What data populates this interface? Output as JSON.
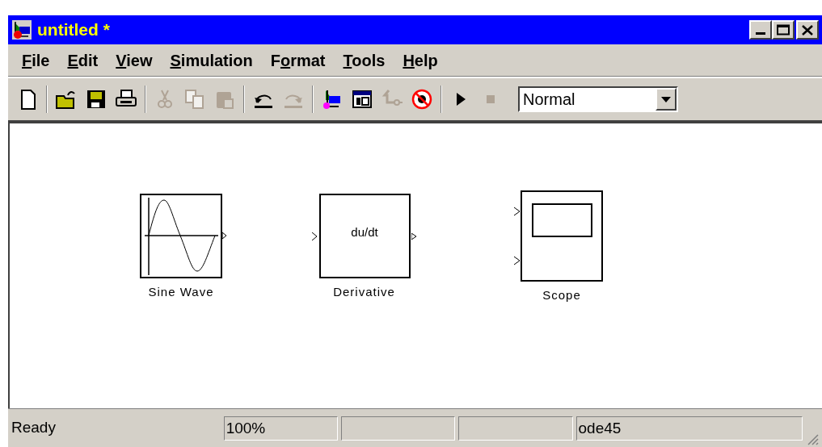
{
  "window": {
    "title": "untitled *"
  },
  "menu": [
    {
      "key": "F",
      "after": "ile"
    },
    {
      "key": "E",
      "after": "dit"
    },
    {
      "key": "V",
      "after": "iew"
    },
    {
      "key": "S",
      "after": "imulation"
    },
    {
      "before": "F",
      "key": "o",
      "after": "rmat"
    },
    {
      "key": "T",
      "after": "ools"
    },
    {
      "key": "H",
      "after": "elp"
    }
  ],
  "toolbar": [
    {
      "kind": "new",
      "disabled": false
    },
    {
      "kind": "separator"
    },
    {
      "kind": "open",
      "disabled": false
    },
    {
      "kind": "save",
      "disabled": false
    },
    {
      "kind": "print",
      "disabled": false
    },
    {
      "kind": "separator"
    },
    {
      "kind": "cut",
      "disabled": true
    },
    {
      "kind": "copy",
      "disabled": true
    },
    {
      "kind": "paste",
      "disabled": true
    },
    {
      "kind": "separator"
    },
    {
      "kind": "undo",
      "disabled": false
    },
    {
      "kind": "redo",
      "disabled": true
    },
    {
      "kind": "separator"
    },
    {
      "kind": "library",
      "disabled": false
    },
    {
      "kind": "explorer",
      "disabled": false
    },
    {
      "kind": "parent",
      "disabled": true
    },
    {
      "kind": "debug",
      "disabled": false
    },
    {
      "kind": "separator"
    },
    {
      "kind": "start",
      "disabled": false
    },
    {
      "kind": "stop",
      "disabled": true
    }
  ],
  "mode_dropdown": {
    "value": "Normal"
  },
  "blocks": [
    {
      "kind": "sine",
      "label": "Sine Wave"
    },
    {
      "kind": "derivative",
      "text": "du/dt",
      "label": "Derivative"
    },
    {
      "kind": "scope",
      "label": "Scope"
    }
  ],
  "status_bar": {
    "message": "Ready",
    "zoom": "100%",
    "solver": "ode45"
  }
}
